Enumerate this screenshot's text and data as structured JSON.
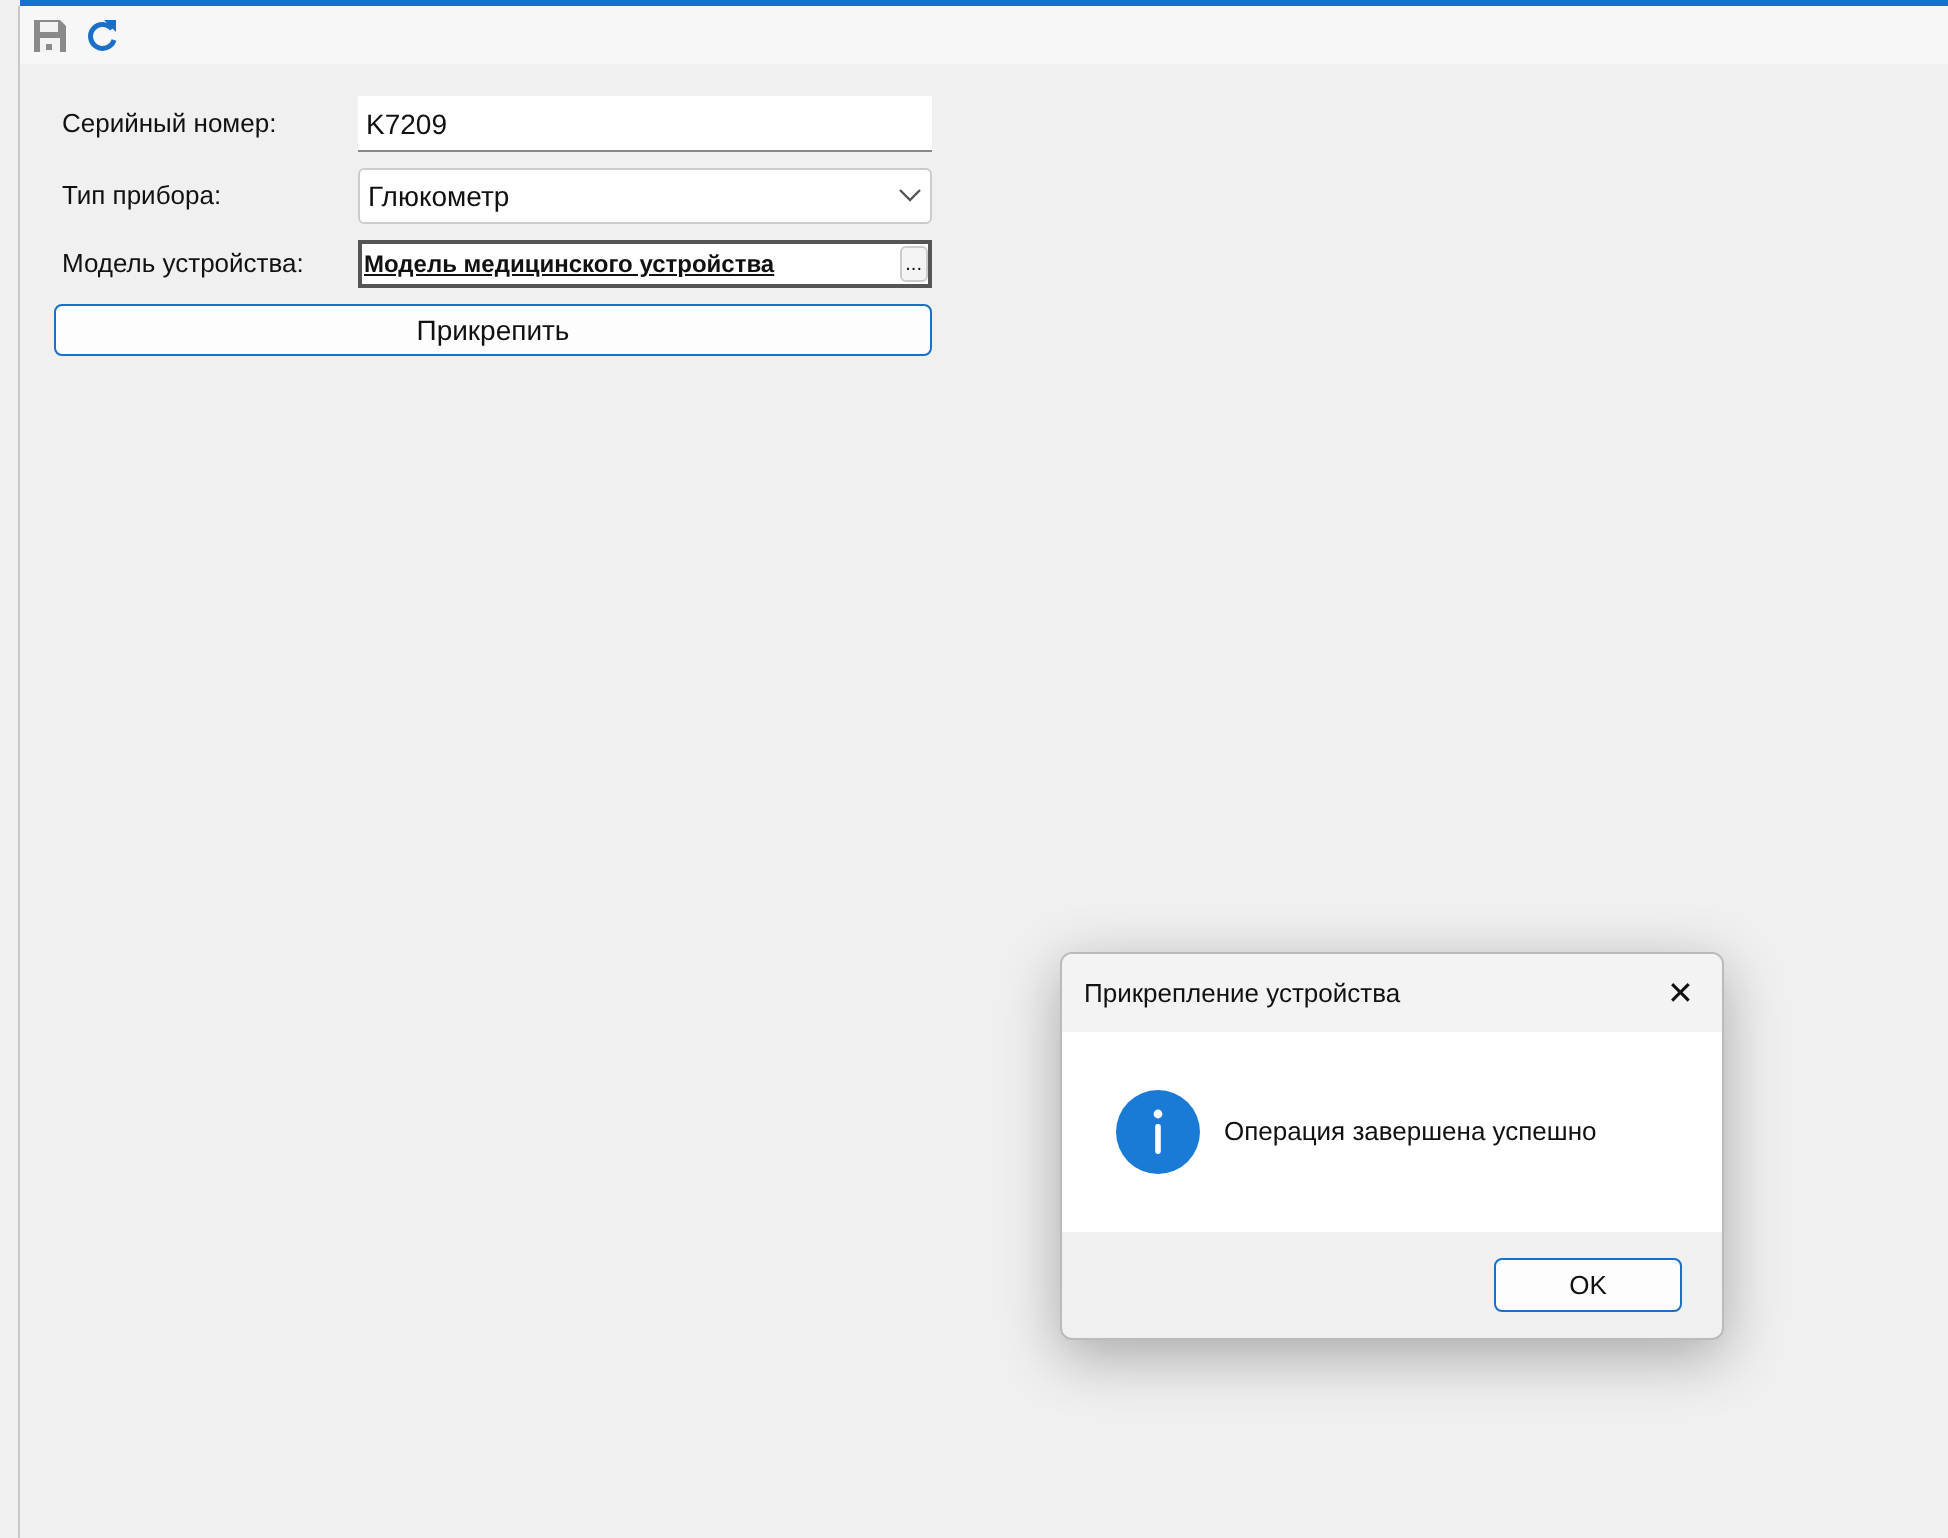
{
  "toolbar": [
    {
      "kind": "save",
      "disabled": true
    },
    {
      "kind": "refresh",
      "disabled": false
    }
  ],
  "form": {
    "fields": [
      {
        "kind": "text",
        "label": "Серийный номер:",
        "value": "K7209"
      },
      {
        "kind": "select",
        "label": "Тип прибора:",
        "value": "Глюкометр"
      },
      {
        "kind": "picker",
        "label": "Модель устройства:",
        "value": "Модель медицинского устройства",
        "button": "..."
      }
    ],
    "submit": "Прикрепить"
  },
  "dialog": {
    "title": "Прикрепление устройства",
    "close": "✕",
    "message": "Операция завершена успешно",
    "buttons": [
      "OK"
    ]
  }
}
